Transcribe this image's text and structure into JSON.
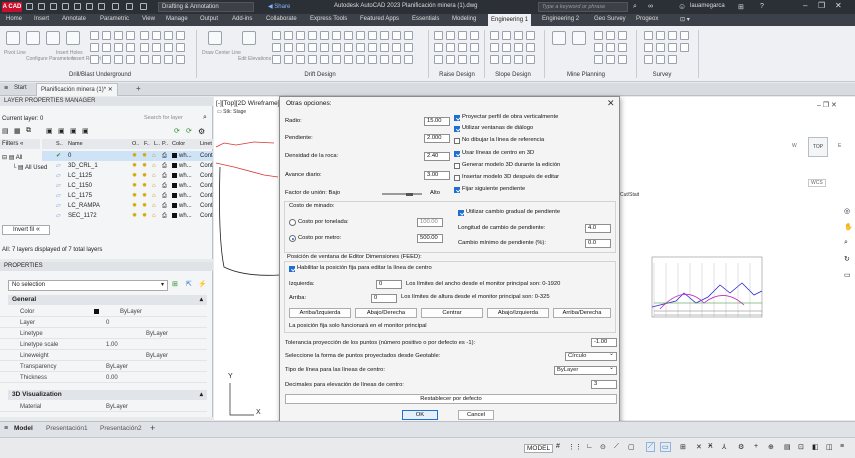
{
  "titlebar": {
    "logo": "A CAD",
    "workspace": "Drafting & Annotation",
    "share": "Share",
    "app_title": "Autodesk AutoCAD 2023   Planificación minera (1).dwg",
    "search_placeholder": "Type a keyword or phrase",
    "user": "lauamegarca"
  },
  "ribbon_tabs": [
    "Home",
    "Insert",
    "Annotate",
    "Parametric",
    "View",
    "Manage",
    "Output",
    "Add-ins",
    "Collaborate",
    "Express Tools",
    "Featured Apps",
    "Essentials",
    "Modeling",
    "Engineering 1",
    "Engineering 2",
    "Geo Survey",
    "Progeox"
  ],
  "ribbon_active_tab": "Engineering 1",
  "ribbon_panels": [
    {
      "label": "Drill/Blast Underground",
      "tools": [
        "Pivot Line",
        "Configure Parameters",
        "Insert Holes",
        "Insert Report"
      ]
    },
    {
      "label": "Drift Design",
      "tools": [
        "Draw Center Line",
        "Edit Elevations"
      ]
    },
    {
      "label": "Raise Design"
    },
    {
      "label": "Slope Design"
    },
    {
      "label": "Mine Planning"
    },
    {
      "label": "Survey"
    }
  ],
  "file_tabs": {
    "start": "Start",
    "active": "Planificación minera (1)*"
  },
  "layers": {
    "header": "LAYER PROPERTIES MANAGER",
    "current_layer": "Current layer: 0",
    "search_placeholder": "Search for layer",
    "filters_label": "Filters",
    "all_label": "All",
    "all_used_label": "All Used",
    "columns": [
      "S..",
      "Name",
      "O..",
      "F..",
      "L..",
      "P..",
      "Color",
      "Linet"
    ],
    "rows": [
      {
        "name": "0",
        "color": "wh...",
        "linetype": "Cont"
      },
      {
        "name": "3D_CRL_1",
        "color": "wh...",
        "linetype": "Cont"
      },
      {
        "name": "LC_1125",
        "color": "wh...",
        "linetype": "Cont"
      },
      {
        "name": "LC_1150",
        "color": "wh...",
        "linetype": "Cont"
      },
      {
        "name": "LC_1175",
        "color": "wh...",
        "linetype": "Cont"
      },
      {
        "name": "LC_RAMPA",
        "color": "wh...",
        "linetype": "Cont"
      },
      {
        "name": "SEC_1172",
        "color": "wh...",
        "linetype": "Cont"
      }
    ],
    "invert_filter": "Invert fil",
    "summary": "All: 7 layers displayed of 7 total layers"
  },
  "properties": {
    "header": "PROPERTIES",
    "selection": "No selection",
    "groups": [
      {
        "name": "General",
        "rows": [
          {
            "key": "Color",
            "value": "ByLayer"
          },
          {
            "key": "Layer",
            "value": "0"
          },
          {
            "key": "Linetype",
            "value": "ByLayer"
          },
          {
            "key": "Linetype scale",
            "value": "1.00"
          },
          {
            "key": "Lineweight",
            "value": "ByLayer"
          },
          {
            "key": "Transparency",
            "value": "ByLayer"
          },
          {
            "key": "Thickness",
            "value": "0.00"
          }
        ]
      },
      {
        "name": "3D Visualization",
        "rows": [
          {
            "key": "Material",
            "value": "ByLayer"
          }
        ]
      }
    ]
  },
  "viewport": {
    "label": "[-][Top][2D Wireframe]",
    "cad_label": "Cut/Stait",
    "viewcube_top": "TOP",
    "viewcube_w": "W",
    "viewcube_e": "E",
    "wcs": "WCS",
    "axis_y": "Y",
    "axis_x": "X"
  },
  "dialog": {
    "title": "Otras opciones:",
    "radio_label": "Radio:",
    "radio_value": "15.00",
    "pendiente_label": "Pendiente:",
    "pendiente_value": "2.000",
    "densidad_label": "Densidad de la roca:",
    "densidad_value": "2.40",
    "avance_label": "Avance diario:",
    "avance_value": "3.00",
    "factor_label": "Factor de unión: Bajo",
    "factor_high": "Alto",
    "checks_right": [
      {
        "label": "Proyectar perfil de obra verticalmente",
        "checked": true
      },
      {
        "label": "Utilizar ventanas de diálogo",
        "checked": true
      },
      {
        "label": "No dibujar la línea de referencia",
        "checked": false
      },
      {
        "label": "Usar líneas de centro en 3D",
        "checked": true
      },
      {
        "label": "Generar modelo 3D durante la edición",
        "checked": false
      },
      {
        "label": "Insertar modelo 3D después de editar",
        "checked": false
      },
      {
        "label": "Fijar siguiente pendiente",
        "checked": true
      }
    ],
    "costo_group": "Costo de minado:",
    "costo_tonelada_label": "Costo por tonelada:",
    "costo_tonelada_value": "100.00",
    "costo_metro_label": "Costo por metro:",
    "costo_metro_value": "500.00",
    "gradual_label": "Utilizar cambio gradual de pendiente",
    "longitud_label": "Longitud de cambio de pendiente:",
    "longitud_value": "4.0",
    "cambio_min_label": "Cambio mínimo de pendiente (%):",
    "cambio_min_value": "0.0",
    "posicion_group": "Posición de ventana de Editor Dimensiones (FEED):",
    "habilitar_label": "Habilitar la posición fija para editar la línea de centro",
    "izquierda_label": "Izquierda:",
    "izquierda_value": "0",
    "izquierda_hint": "Los límites del ancho desde el monitor principal son: 0-1920",
    "arriba_label": "Arriba:",
    "arriba_value": "0",
    "arriba_hint": "Los límites de altura desde el monitor principal son: 0-325",
    "pos_buttons": [
      "Arriba/Izquierda",
      "Abajo/Derecha",
      "Centrar",
      "Abajo/Izquierda",
      "Arriba/Derecha"
    ],
    "pos_note": "La posición fija solo funcionará en el monitor principal",
    "tolerancia_label": "Tolerancia proyección de los puntos (número positivo o por defecto es -1):",
    "tolerancia_value": "-1.00",
    "forma_label": "Seleccione la forma de puntos proyectados desde Geotable:",
    "forma_value": "Círculo",
    "tipo_label": "Tipo de línea para las líneas de centro:",
    "tipo_value": "ByLayer",
    "decimales_label": "Decimales para elevación de líneas de centro:",
    "decimales_value": "3",
    "restablecer": "Restablecer por defecto",
    "ok": "OK",
    "cancel": "Cancel"
  },
  "model_tabs": [
    "Model",
    "Presentación1",
    "Presentación2"
  ],
  "status": {
    "model": "MODEL"
  }
}
